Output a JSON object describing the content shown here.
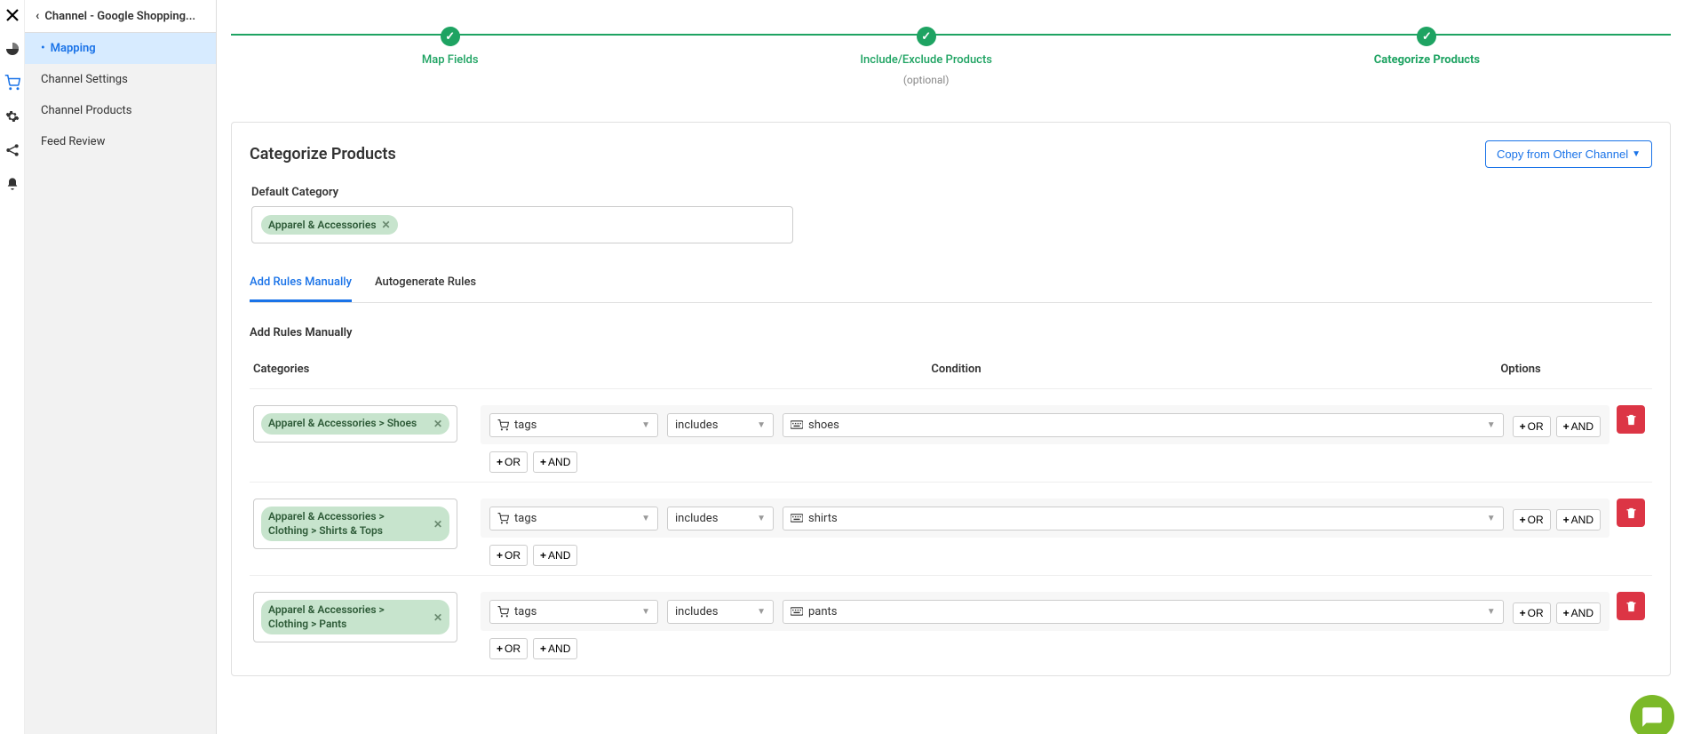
{
  "sidebar": {
    "title": "Channel - Google Shopping...",
    "items": [
      {
        "label": "Mapping"
      },
      {
        "label": "Channel Settings"
      },
      {
        "label": "Channel Products"
      },
      {
        "label": "Feed Review"
      }
    ]
  },
  "stepper": [
    {
      "label": "Map Fields",
      "sub": ""
    },
    {
      "label": "Include/Exclude Products",
      "sub": "(optional)"
    },
    {
      "label": "Categorize Products",
      "sub": ""
    }
  ],
  "panel": {
    "title": "Categorize Products",
    "copy_label": "Copy from Other Channel",
    "default_category_label": "Default Category",
    "default_category_pill": "Apparel & Accessories"
  },
  "tabs": [
    {
      "label": "Add Rules Manually"
    },
    {
      "label": "Autogenerate Rules"
    }
  ],
  "rules_section": {
    "heading": "Add Rules Manually",
    "head_categories": "Categories",
    "head_condition": "Condition",
    "head_options": "Options",
    "or_label": "OR",
    "and_label": "AND"
  },
  "rules": [
    {
      "category": "Apparel & Accessories > Shoes",
      "field": "tags",
      "op": "includes",
      "value": "shoes"
    },
    {
      "category": "Apparel & Accessories > Clothing > Shirts & Tops",
      "field": "tags",
      "op": "includes",
      "value": "shirts"
    },
    {
      "category": "Apparel & Accessories > Clothing > Pants",
      "field": "tags",
      "op": "includes",
      "value": "pants"
    }
  ]
}
